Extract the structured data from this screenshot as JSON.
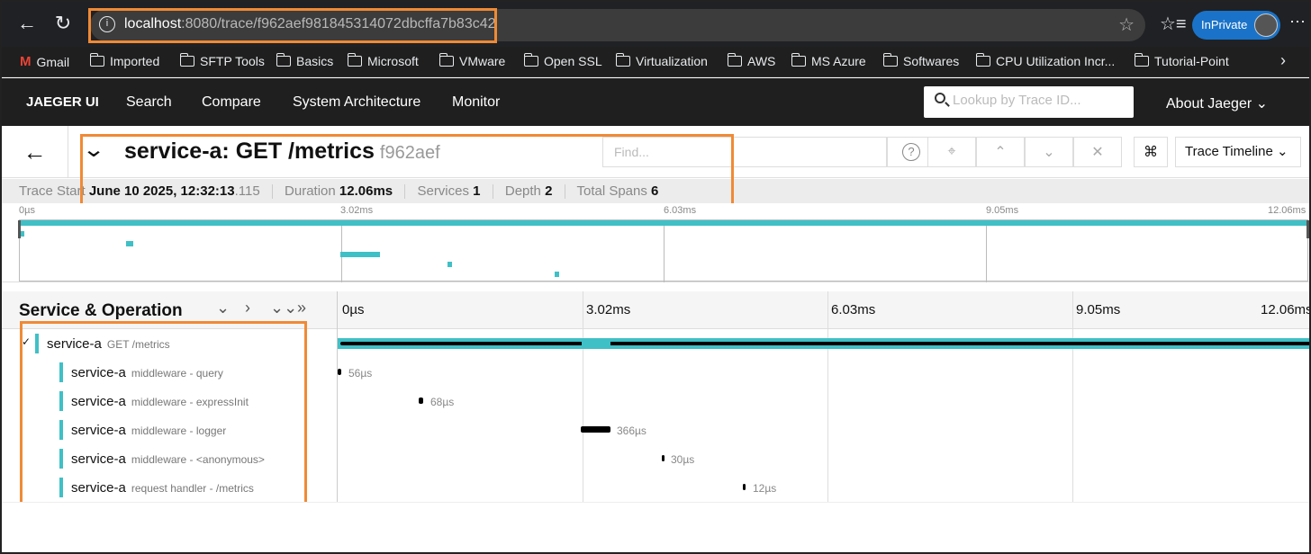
{
  "browser": {
    "url_host": "localhost",
    "url_path": ":8080/trace/f962aef981845314072dbcffa7b83c42",
    "profile_label": "InPrivate"
  },
  "bookmarks": [
    "Gmail",
    "Imported",
    "SFTP Tools",
    "Basics",
    "Microsoft",
    "VMware",
    "Open SSL",
    "Virtualization",
    "AWS",
    "MS Azure",
    "Softwares",
    "CPU Utilization Incr...",
    "Tutorial-Point"
  ],
  "nav": {
    "brand": "JAEGER UI",
    "items": [
      "Search",
      "Compare",
      "System Architecture",
      "Monitor"
    ],
    "lookup_placeholder": "Lookup by Trace ID...",
    "about": "About Jaeger"
  },
  "trace": {
    "title": "service-a: GET /metrics",
    "id_short": "f962aef",
    "find_placeholder": "Find...",
    "view_select": "Trace Timeline",
    "meta": {
      "start_label": "Trace Start",
      "start_value": "June 10 2025, 12:32:13",
      "start_ms": ".115",
      "duration_label": "Duration",
      "duration_value": "12.06ms",
      "services_label": "Services",
      "services_value": "1",
      "depth_label": "Depth",
      "depth_value": "2",
      "spans_label": "Total Spans",
      "spans_value": "6"
    }
  },
  "timeline": {
    "ticks": [
      "0µs",
      "3.02ms",
      "6.03ms",
      "9.05ms",
      "12.06ms"
    ],
    "header": "Service & Operation"
  },
  "spans": [
    {
      "service": "service-a",
      "operation": "GET /metrics",
      "duration": ""
    },
    {
      "service": "service-a",
      "operation": "middleware - query",
      "duration": "56µs"
    },
    {
      "service": "service-a",
      "operation": "middleware - expressInit",
      "duration": "68µs"
    },
    {
      "service": "service-a",
      "operation": "middleware - logger",
      "duration": "366µs"
    },
    {
      "service": "service-a",
      "operation": "middleware - <anonymous>",
      "duration": "30µs"
    },
    {
      "service": "service-a",
      "operation": "request handler - /metrics",
      "duration": "12µs"
    }
  ],
  "colors": {
    "span": "#3fc0c6",
    "highlight": "#f08a35",
    "nav_bg": "#1f1f1f"
  }
}
